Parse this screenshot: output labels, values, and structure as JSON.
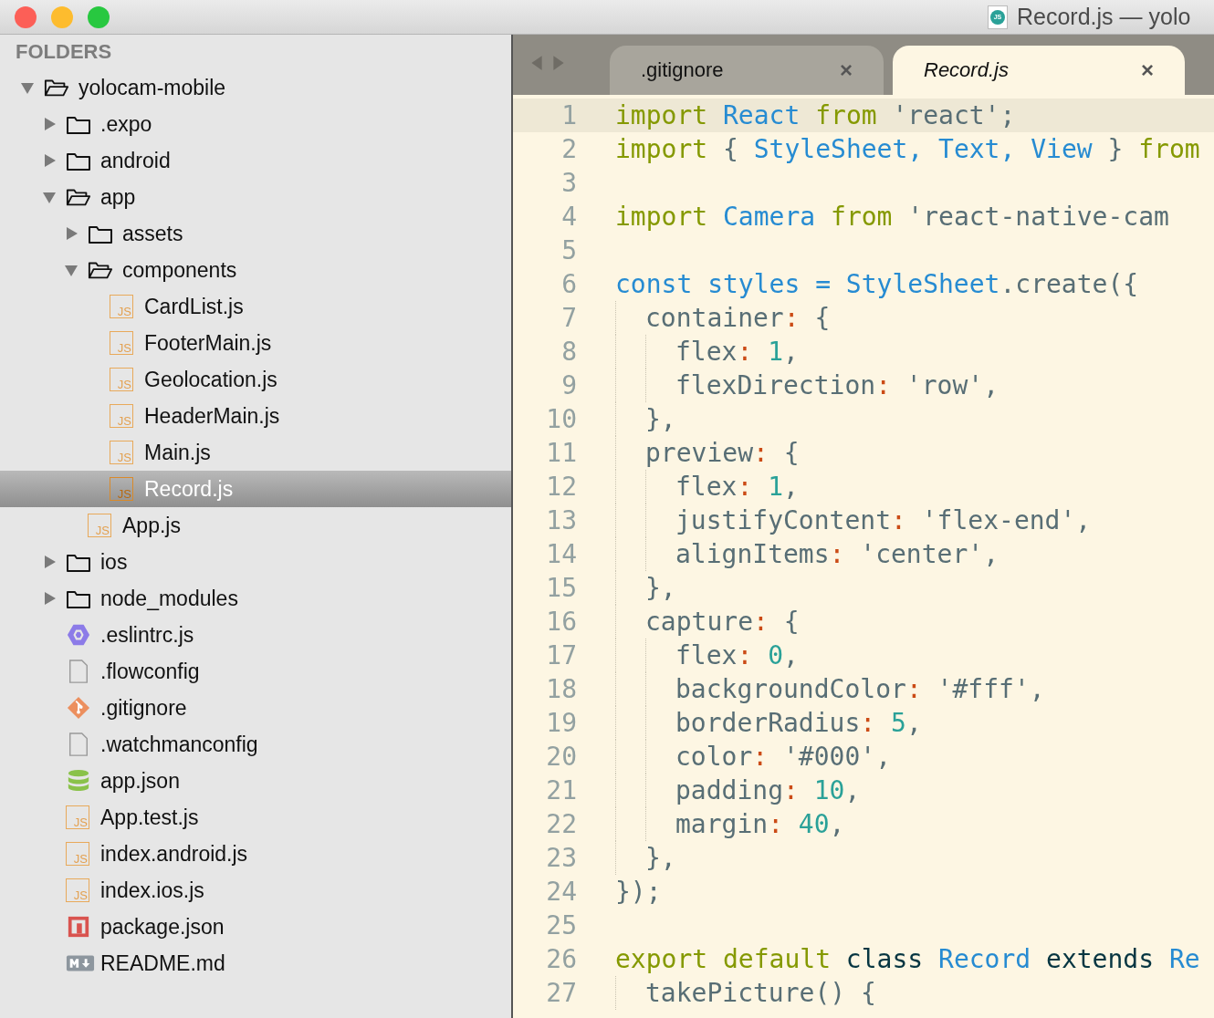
{
  "window": {
    "title": "Record.js — yolo",
    "icon_text": "JS"
  },
  "sidebar": {
    "heading": "FOLDERS",
    "tree": [
      {
        "label": "yolocam-mobile",
        "kind": "folder",
        "expanded": true,
        "selected": false,
        "children": [
          {
            "label": ".expo",
            "kind": "folder",
            "expanded": false,
            "selected": false
          },
          {
            "label": "android",
            "kind": "folder",
            "expanded": false,
            "selected": false
          },
          {
            "label": "app",
            "kind": "folder",
            "expanded": true,
            "selected": false,
            "children": [
              {
                "label": "assets",
                "kind": "folder",
                "expanded": false,
                "selected": false
              },
              {
                "label": "components",
                "kind": "folder",
                "expanded": true,
                "selected": false,
                "children": [
                  {
                    "label": "CardList.js",
                    "kind": "js",
                    "icon_text": "JS",
                    "selected": false
                  },
                  {
                    "label": "FooterMain.js",
                    "kind": "js",
                    "icon_text": "JS",
                    "selected": false
                  },
                  {
                    "label": "Geolocation.js",
                    "kind": "js",
                    "icon_text": "JS",
                    "selected": false
                  },
                  {
                    "label": "HeaderMain.js",
                    "kind": "js",
                    "icon_text": "JS",
                    "selected": false
                  },
                  {
                    "label": "Main.js",
                    "kind": "js",
                    "icon_text": "JS",
                    "selected": false
                  },
                  {
                    "label": "Record.js",
                    "kind": "js",
                    "icon_text": "JS",
                    "selected": true
                  }
                ]
              },
              {
                "label": "App.js",
                "kind": "js",
                "icon_text": "JS",
                "selected": false
              }
            ]
          },
          {
            "label": "ios",
            "kind": "folder",
            "expanded": false,
            "selected": false
          },
          {
            "label": "node_modules",
            "kind": "folder",
            "expanded": false,
            "selected": false
          },
          {
            "label": ".eslintrc.js",
            "kind": "eslint",
            "selected": false
          },
          {
            "label": ".flowconfig",
            "kind": "file",
            "selected": false
          },
          {
            "label": ".gitignore",
            "kind": "git",
            "selected": false
          },
          {
            "label": ".watchmanconfig",
            "kind": "file",
            "selected": false
          },
          {
            "label": "app.json",
            "kind": "db",
            "selected": false
          },
          {
            "label": "App.test.js",
            "kind": "js",
            "icon_text": "JS",
            "selected": false
          },
          {
            "label": "index.android.js",
            "kind": "js",
            "icon_text": "JS",
            "selected": false
          },
          {
            "label": "index.ios.js",
            "kind": "js",
            "icon_text": "JS",
            "selected": false
          },
          {
            "label": "package.json",
            "kind": "npm",
            "selected": false
          },
          {
            "label": "README.md",
            "kind": "md",
            "selected": false
          }
        ]
      }
    ]
  },
  "tabs": [
    {
      "label": ".gitignore",
      "selected": false,
      "close": "×"
    },
    {
      "label": "Record.js",
      "selected": true,
      "close": "×"
    }
  ],
  "editor": {
    "lines": [
      {
        "number": "1",
        "current": true,
        "tokens": [
          {
            "kind": "keyword",
            "text": "import"
          },
          {
            "kind": "name",
            "text": " React"
          },
          {
            "kind": "keyword",
            "text": " from"
          },
          {
            "kind": "string",
            "text": " 'react';"
          }
        ]
      },
      {
        "number": "2",
        "current": false,
        "tokens": [
          {
            "kind": "keyword",
            "text": "import"
          },
          {
            "kind": "plain",
            "text": " {"
          },
          {
            "kind": "name",
            "text": " StyleSheet,"
          },
          {
            "kind": "name",
            "text": " Text,"
          },
          {
            "kind": "name",
            "text": " View"
          },
          {
            "kind": "plain",
            "text": " }"
          },
          {
            "kind": "keyword",
            "text": " from"
          }
        ]
      },
      {
        "number": "3",
        "current": false
      },
      {
        "number": "4",
        "current": false,
        "tokens": [
          {
            "kind": "keyword",
            "text": "import"
          },
          {
            "kind": "name",
            "text": " Camera"
          },
          {
            "kind": "keyword",
            "text": " from"
          },
          {
            "kind": "string",
            "text": " 'react-native-cam"
          }
        ]
      },
      {
        "number": "5",
        "current": false
      },
      {
        "number": "6",
        "current": false,
        "tokens": [
          {
            "kind": "name",
            "text": "const styles = StyleSheet"
          },
          {
            "kind": "plain",
            "text": ".create({"
          }
        ],
        "children": [
          {
            "number": "7",
            "current": false,
            "tokens": [
              {
                "kind": "plain",
                "text": "container"
              },
              {
                "kind": "colon",
                "text": ":"
              },
              {
                "kind": "plain",
                "text": " {"
              }
            ],
            "children": [
              {
                "number": "8",
                "current": false,
                "tokens": [
                  {
                    "kind": "plain",
                    "text": "flex"
                  },
                  {
                    "kind": "colon",
                    "text": ":"
                  },
                  {
                    "kind": "number",
                    "text": " 1"
                  },
                  {
                    "kind": "plain",
                    "text": ","
                  }
                ]
              },
              {
                "number": "9",
                "current": false,
                "tokens": [
                  {
                    "kind": "plain",
                    "text": "flexDirection"
                  },
                  {
                    "kind": "colon",
                    "text": ":"
                  },
                  {
                    "kind": "string",
                    "text": " 'row',"
                  }
                ]
              }
            ]
          },
          {
            "number": "10",
            "current": false,
            "tokens": [
              {
                "kind": "plain",
                "text": "},"
              }
            ]
          },
          {
            "number": "11",
            "current": false,
            "tokens": [
              {
                "kind": "plain",
                "text": "preview"
              },
              {
                "kind": "colon",
                "text": ":"
              },
              {
                "kind": "plain",
                "text": " {"
              }
            ],
            "children": [
              {
                "number": "12",
                "current": false,
                "tokens": [
                  {
                    "kind": "plain",
                    "text": "flex"
                  },
                  {
                    "kind": "colon",
                    "text": ":"
                  },
                  {
                    "kind": "number",
                    "text": " 1"
                  },
                  {
                    "kind": "plain",
                    "text": ","
                  }
                ]
              },
              {
                "number": "13",
                "current": false,
                "tokens": [
                  {
                    "kind": "plain",
                    "text": "justifyContent"
                  },
                  {
                    "kind": "colon",
                    "text": ":"
                  },
                  {
                    "kind": "string",
                    "text": " 'flex-end',"
                  }
                ]
              },
              {
                "number": "14",
                "current": false,
                "tokens": [
                  {
                    "kind": "plain",
                    "text": "alignItems"
                  },
                  {
                    "kind": "colon",
                    "text": ":"
                  },
                  {
                    "kind": "string",
                    "text": " 'center',"
                  }
                ]
              }
            ]
          },
          {
            "number": "15",
            "current": false,
            "tokens": [
              {
                "kind": "plain",
                "text": "},"
              }
            ]
          },
          {
            "number": "16",
            "current": false,
            "tokens": [
              {
                "kind": "plain",
                "text": "capture"
              },
              {
                "kind": "colon",
                "text": ":"
              },
              {
                "kind": "plain",
                "text": " {"
              }
            ],
            "children": [
              {
                "number": "17",
                "current": false,
                "tokens": [
                  {
                    "kind": "plain",
                    "text": "flex"
                  },
                  {
                    "kind": "colon",
                    "text": ":"
                  },
                  {
                    "kind": "number",
                    "text": " 0"
                  },
                  {
                    "kind": "plain",
                    "text": ","
                  }
                ]
              },
              {
                "number": "18",
                "current": false,
                "tokens": [
                  {
                    "kind": "plain",
                    "text": "backgroundColor"
                  },
                  {
                    "kind": "colon",
                    "text": ":"
                  },
                  {
                    "kind": "string",
                    "text": " '#fff',"
                  }
                ]
              },
              {
                "number": "19",
                "current": false,
                "tokens": [
                  {
                    "kind": "plain",
                    "text": "borderRadius"
                  },
                  {
                    "kind": "colon",
                    "text": ":"
                  },
                  {
                    "kind": "number",
                    "text": " 5"
                  },
                  {
                    "kind": "plain",
                    "text": ","
                  }
                ]
              },
              {
                "number": "20",
                "current": false,
                "tokens": [
                  {
                    "kind": "plain",
                    "text": "color"
                  },
                  {
                    "kind": "colon",
                    "text": ":"
                  },
                  {
                    "kind": "string",
                    "text": " '#000',"
                  }
                ]
              },
              {
                "number": "21",
                "current": false,
                "tokens": [
                  {
                    "kind": "plain",
                    "text": "padding"
                  },
                  {
                    "kind": "colon",
                    "text": ":"
                  },
                  {
                    "kind": "number",
                    "text": " 10"
                  },
                  {
                    "kind": "plain",
                    "text": ","
                  }
                ]
              },
              {
                "number": "22",
                "current": false,
                "tokens": [
                  {
                    "kind": "plain",
                    "text": "margin"
                  },
                  {
                    "kind": "colon",
                    "text": ":"
                  },
                  {
                    "kind": "number",
                    "text": " 40"
                  },
                  {
                    "kind": "plain",
                    "text": ","
                  }
                ]
              }
            ]
          },
          {
            "number": "23",
            "current": false,
            "tokens": [
              {
                "kind": "plain",
                "text": "},"
              }
            ]
          }
        ]
      },
      {
        "number": "24",
        "current": false,
        "tokens": [
          {
            "kind": "plain",
            "text": "});"
          }
        ]
      },
      {
        "number": "25",
        "current": false
      },
      {
        "number": "26",
        "current": false,
        "tokens": [
          {
            "kind": "keyword",
            "text": "export default"
          },
          {
            "kind": "dark",
            "text": " class"
          },
          {
            "kind": "name",
            "text": " Record"
          },
          {
            "kind": "dark",
            "text": " extends"
          },
          {
            "kind": "name",
            "text": " Re"
          }
        ],
        "children": [
          {
            "number": "27",
            "current": false,
            "tokens": [
              {
                "kind": "plain",
                "text": "takePicture() {"
              }
            ]
          }
        ]
      }
    ]
  }
}
